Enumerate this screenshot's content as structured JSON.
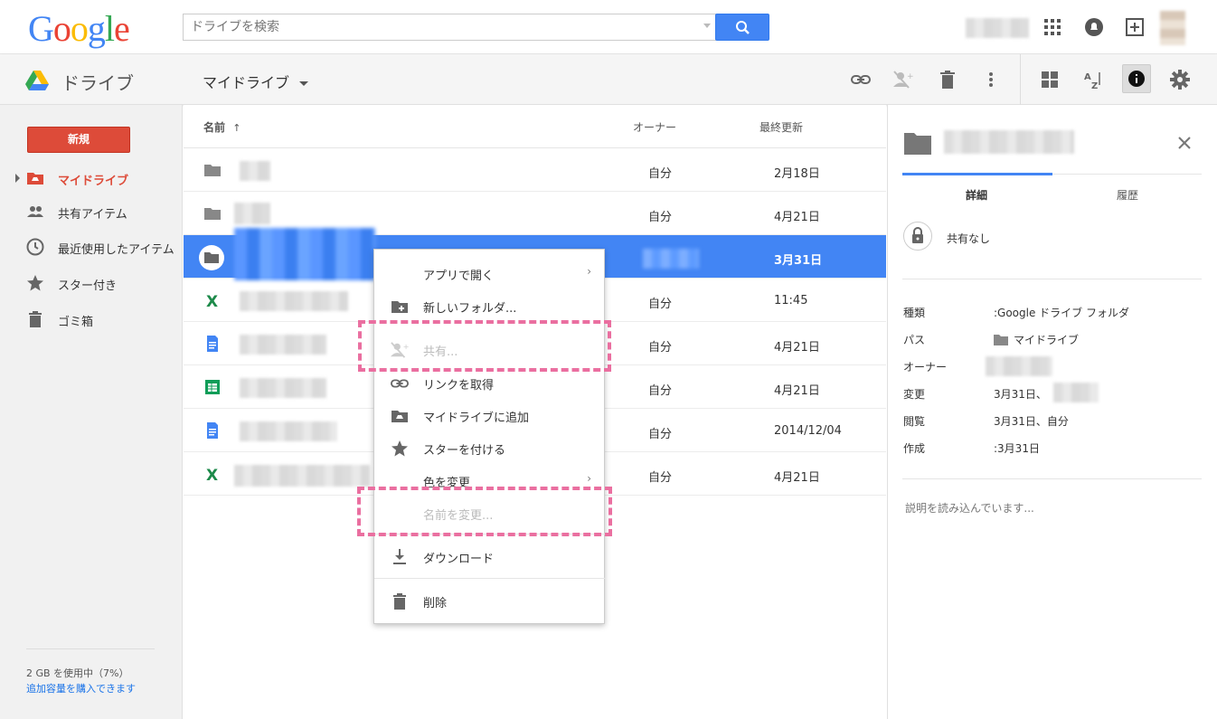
{
  "header": {
    "logo": "Google",
    "search_placeholder": "ドライブを検索"
  },
  "toolbar": {
    "app_name": "ドライブ",
    "location": "マイドライブ"
  },
  "sidebar": {
    "new_button": "新規",
    "items": [
      {
        "label": "マイドライブ",
        "icon": "drive-folder-icon",
        "active": true
      },
      {
        "label": "共有アイテム",
        "icon": "people-icon"
      },
      {
        "label": "最近使用したアイテム",
        "icon": "clock-icon"
      },
      {
        "label": "スター付き",
        "icon": "star-icon"
      },
      {
        "label": "ゴミ箱",
        "icon": "trash-icon"
      }
    ],
    "storage_used": "2 GB を使用中（7%）",
    "buy_storage": "追加容量を購入できます"
  },
  "list": {
    "columns": {
      "name": "名前",
      "sort_indicator": "↑",
      "owner": "オーナー",
      "modified": "最終更新"
    },
    "rows": [
      {
        "type": "folder",
        "owner": "自分",
        "modified": "2月18日"
      },
      {
        "type": "folder",
        "owner": "自分",
        "modified": "4月21日"
      },
      {
        "type": "folder",
        "owner": "",
        "modified": "3月31日",
        "selected": true
      },
      {
        "type": "excel",
        "owner": "自分",
        "modified": "11:45"
      },
      {
        "type": "doc",
        "owner": "自分",
        "modified": "4月21日"
      },
      {
        "type": "sheet",
        "owner": "自分",
        "modified": "4月21日"
      },
      {
        "type": "doc",
        "owner": "自分",
        "modified": "2014/12/04"
      },
      {
        "type": "excel",
        "owner": "自分",
        "modified": "4月21日"
      }
    ]
  },
  "context_menu": {
    "items": [
      {
        "label": "アプリで開く",
        "icon": "",
        "submenu": true
      },
      {
        "label": "新しいフォルダ...",
        "icon": "new-folder-icon"
      },
      {
        "label": "共有...",
        "icon": "share-icon",
        "disabled": true
      },
      {
        "label": "リンクを取得",
        "icon": "link-icon"
      },
      {
        "label": "マイドライブに追加",
        "icon": "add-to-drive-icon"
      },
      {
        "label": "スターを付ける",
        "icon": "star-icon"
      },
      {
        "label": "色を変更",
        "icon": "",
        "submenu": true
      },
      {
        "label": "名前を変更...",
        "icon": "",
        "disabled": true
      },
      {
        "label": "ダウンロード",
        "icon": "download-icon"
      },
      {
        "label": "削除",
        "icon": "trash-icon"
      }
    ]
  },
  "details": {
    "tabs": [
      "詳細",
      "履歴"
    ],
    "sharing": "共有なし",
    "props": [
      {
        "key": "種類",
        "value": ":Google ドライブ フォルダ"
      },
      {
        "key": "パス",
        "value": "マイドライブ"
      },
      {
        "key": "オーナー",
        "value": ""
      },
      {
        "key": "変更",
        "value": "3月31日、"
      },
      {
        "key": "閲覧",
        "value": "3月31日、自分"
      },
      {
        "key": "作成",
        "value": ":3月31日"
      }
    ],
    "description_loading": "説明を読み込んでいます..."
  },
  "colors": {
    "accent_blue": "#4285f4",
    "new_red": "#dd4b39",
    "highlight_pink": "#ea6fa0"
  }
}
